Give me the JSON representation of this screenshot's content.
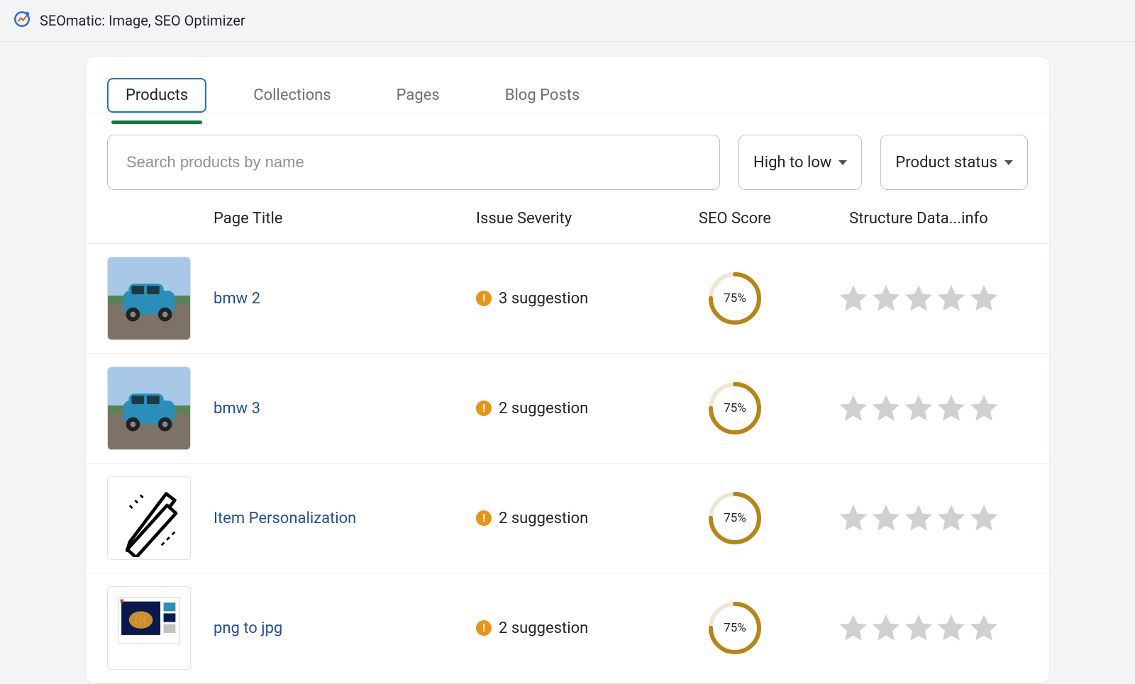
{
  "header": {
    "title": "SEOmatic: Image, SEO Optimizer"
  },
  "tabs": [
    {
      "label": "Products",
      "active": true
    },
    {
      "label": "Collections",
      "active": false
    },
    {
      "label": "Pages",
      "active": false
    },
    {
      "label": "Blog Posts",
      "active": false
    }
  ],
  "search": {
    "placeholder": "Search products by name",
    "value": ""
  },
  "sort": {
    "label": "High to low"
  },
  "status_filter": {
    "label": "Product status"
  },
  "columns": {
    "page_title": "Page Title",
    "issue_severity": "Issue Severity",
    "seo_score": "SEO Score",
    "structure_data": "Structure Data...info"
  },
  "rows": [
    {
      "thumb_type": "car",
      "title": "bmw 2",
      "issue_count": 3,
      "issue_label": "3 suggestion",
      "score_pct": 75,
      "score_label": "75%",
      "rating": 0
    },
    {
      "thumb_type": "car",
      "title": "bmw 3",
      "issue_count": 2,
      "issue_label": "2 suggestion",
      "score_pct": 75,
      "score_label": "75%",
      "rating": 0
    },
    {
      "thumb_type": "tools",
      "title": "Item Personalization",
      "issue_count": 2,
      "issue_label": "2 suggestion",
      "score_pct": 75,
      "score_label": "75%",
      "rating": 0
    },
    {
      "thumb_type": "screenshot",
      "title": "png to jpg",
      "issue_count": 2,
      "issue_label": "2 suggestion",
      "score_pct": 75,
      "score_label": "75%",
      "rating": 0
    }
  ]
}
